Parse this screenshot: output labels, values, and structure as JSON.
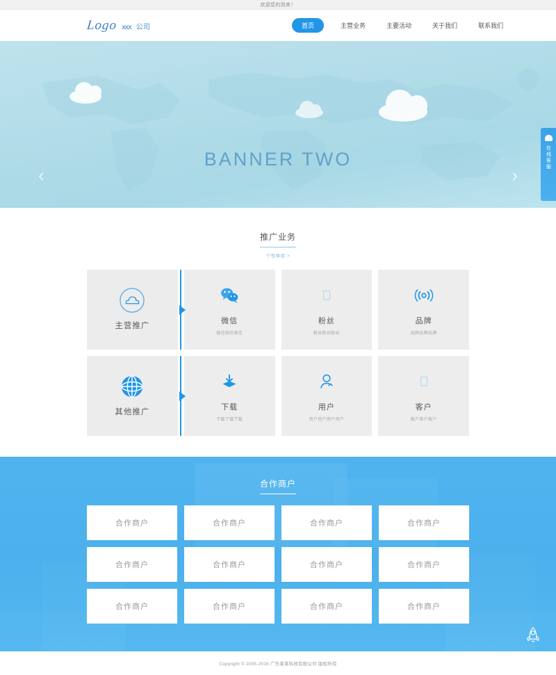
{
  "topbar": {
    "welcome": "欢迎您的到来！"
  },
  "header": {
    "logo_script": "Logo",
    "logo_xxx": "xxx",
    "logo_company": "公司",
    "nav": [
      {
        "label": "首页",
        "active": true
      },
      {
        "label": "主营业务",
        "active": false
      },
      {
        "label": "主要活动",
        "active": false
      },
      {
        "label": "关于我们",
        "active": false
      },
      {
        "label": "联系我们",
        "active": false
      }
    ]
  },
  "banner": {
    "title": "BANNER TWO",
    "prev_arrow": "‹",
    "next_arrow": "›",
    "bg_color": "#b3dde9",
    "title_color": "#5fa2c9"
  },
  "service_tab": {
    "text": "在线客服",
    "icon": "headset-icon",
    "color": "#3aa3e8"
  },
  "services": {
    "title": "推广业务",
    "subtitle": "个性体验 >",
    "accent": "#2196e8",
    "cards": [
      {
        "title": "主营推广",
        "subtitle": "",
        "icon": "cloud-circle-icon",
        "feature": true
      },
      {
        "title": "微信",
        "subtitle": "微信微信微信",
        "icon": "wechat-icon",
        "feature": false
      },
      {
        "title": "粉丝",
        "subtitle": "粉丝粉丝粉丝",
        "icon": "fans-icon",
        "feature": false
      },
      {
        "title": "品牌",
        "subtitle": "品牌品牌品牌",
        "icon": "broadcast-icon",
        "feature": false
      },
      {
        "title": "其他推广",
        "subtitle": "",
        "icon": "globe-icon",
        "feature": true
      },
      {
        "title": "下载",
        "subtitle": "下载下载下载",
        "icon": "download-icon",
        "feature": false
      },
      {
        "title": "用户",
        "subtitle": "用户用户用户用户",
        "icon": "user-icon",
        "feature": false
      },
      {
        "title": "客户",
        "subtitle": "客户客户客户",
        "icon": "customer-icon",
        "feature": false
      }
    ]
  },
  "partners": {
    "title": "合作商户",
    "bg_color": "#4fb4ee",
    "items": [
      {
        "label": "合作商户"
      },
      {
        "label": "合作商户"
      },
      {
        "label": "合作商户"
      },
      {
        "label": "合作商户"
      },
      {
        "label": "合作商户"
      },
      {
        "label": "合作商户"
      },
      {
        "label": "合作商户"
      },
      {
        "label": "合作商户"
      },
      {
        "label": "合作商户"
      },
      {
        "label": "合作商户"
      },
      {
        "label": "合作商户"
      },
      {
        "label": "合作商户"
      }
    ]
  },
  "footer": {
    "copyright": "Copyright © 2005-2016 广东某某科技有限公司 版权所有"
  },
  "back_to_top": {
    "icon": "rocket-icon"
  }
}
